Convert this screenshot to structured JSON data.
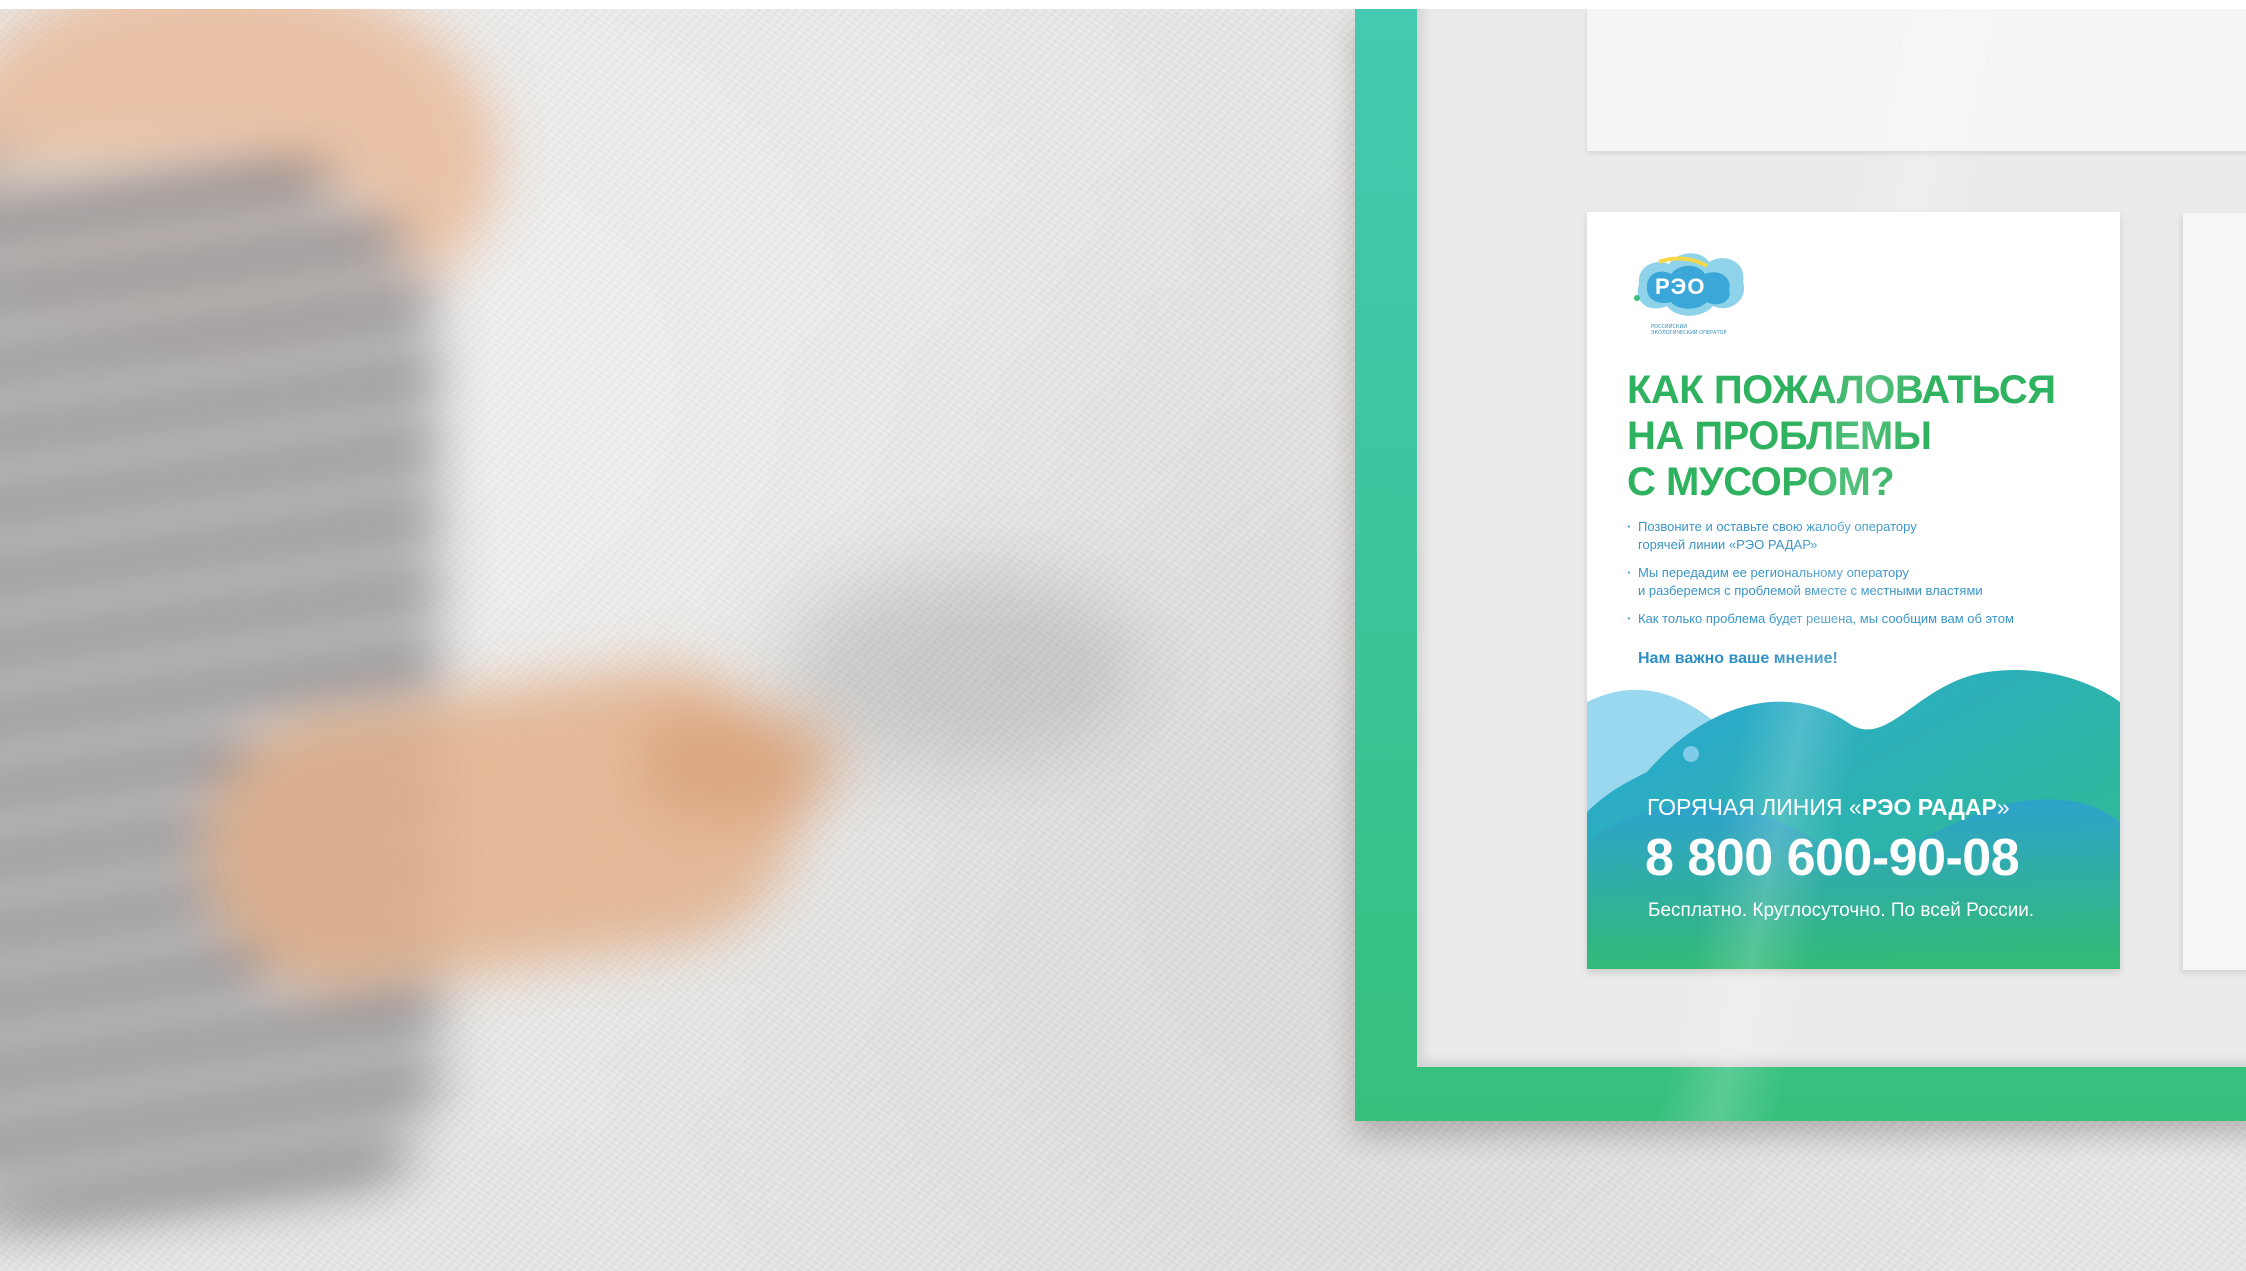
{
  "poster": {
    "logo_text": "РЭО",
    "logo_caption": "РОССИЙСКИЙ ЭКОЛОГИЧЕСКИЙ ОПЕРАТОР",
    "title_lines": [
      "КАК ПОЖАЛОВАТЬСЯ",
      "НА ПРОБЛЕМЫ",
      "С МУСОРОМ?"
    ],
    "bullets": [
      {
        "line1": "Позвоните и оставьте свою жалобу оператору",
        "line2": "горячей линии «РЭО РАДАР»"
      },
      {
        "line1": "Мы передадим ее региональному оператору",
        "line2": "и разберемся с проблемой вместе с местными властями"
      },
      {
        "line1": "Как только проблема будет решена, мы сообщим вам об этом",
        "line2": ""
      }
    ],
    "note": "Нам важно ваше мнение!",
    "hotline": {
      "label_prefix": "ГОРЯЧАЯ ЛИНИЯ «",
      "label_bold": "РЭО РАДАР",
      "label_suffix": "»",
      "number": "8 800 600-90-08",
      "subtitle": "Бесплатно. Круглосуточно. По всей России."
    }
  },
  "colors": {
    "frame": "#3cc49a",
    "title_green": "#2fb25f",
    "text_blue": "#3a95c6",
    "wave_blue": "#29a6d6",
    "wave_green": "#33bb7a"
  }
}
